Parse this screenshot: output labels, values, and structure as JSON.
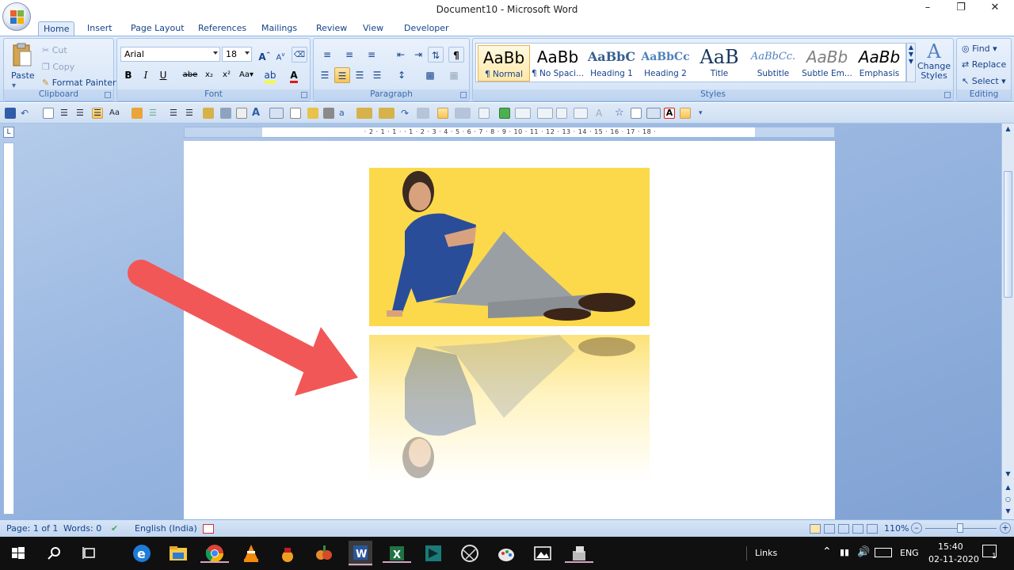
{
  "window": {
    "title": "Document10 - Microsoft Word"
  },
  "tabs": [
    "Home",
    "Insert",
    "Page Layout",
    "References",
    "Mailings",
    "Review",
    "View",
    "Developer"
  ],
  "ribbon": {
    "clipboard": {
      "label": "Clipboard",
      "paste": "Paste",
      "cut": "Cut",
      "copy": "Copy",
      "format_painter": "Format Painter"
    },
    "font": {
      "label": "Font",
      "name": "Arial",
      "size": "18"
    },
    "paragraph": {
      "label": "Paragraph"
    },
    "styles": {
      "label": "Styles",
      "items": [
        {
          "sample": "AaBb",
          "name": "¶ Normal"
        },
        {
          "sample": "AaBb",
          "name": "¶ No Spaci..."
        },
        {
          "sample": "AaBbC",
          "name": "Heading 1"
        },
        {
          "sample": "AaBbCc",
          "name": "Heading 2"
        },
        {
          "sample": "AaB",
          "name": "Title"
        },
        {
          "sample": "AaBbCc.",
          "name": "Subtitle"
        },
        {
          "sample": "AaBb",
          "name": "Subtle Em..."
        },
        {
          "sample": "AaBb",
          "name": "Emphasis"
        }
      ],
      "change_styles": "Change Styles"
    },
    "editing": {
      "label": "Editing",
      "find": "Find",
      "replace": "Replace",
      "select": "Select"
    }
  },
  "ruler": {
    "numbers": "· 2 · 1 · 1 · · 1 · 2 · 3 · 4 · 5 · 6 · 7 · 8 · 9 · 10 · 11 · 12 · 13 · 14 · 15 · 16 · 17 · 18 ·"
  },
  "status": {
    "page": "Page: 1 of 1",
    "words": "Words: 0",
    "language": "English (India)",
    "zoom": "110%"
  },
  "taskbar": {
    "links": "Links",
    "lang": "ENG",
    "time": "15:40",
    "date": "02-11-2020",
    "notif_count": "1"
  }
}
